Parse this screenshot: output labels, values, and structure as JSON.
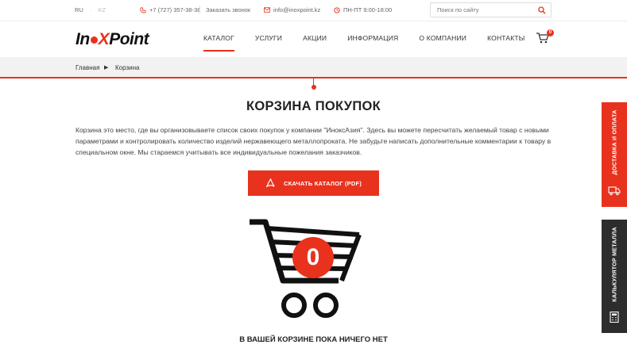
{
  "topbar": {
    "lang_ru": "RU",
    "lang_sep": "·",
    "lang_kz": "KZ",
    "phone": "+7 (727) 357-38-38",
    "callback": "Заказать звонок",
    "email": "info@inoxpoint.kz",
    "hours": "ПН-ПТ  9:00-18:00",
    "search_placeholder": "Поиск по сайту"
  },
  "header": {
    "logo": {
      "part1": "In",
      "part2": "X",
      "part3": "Point"
    },
    "nav": [
      {
        "label": "КАТАЛОГ",
        "active": true
      },
      {
        "label": "УСЛУГИ"
      },
      {
        "label": "АКЦИИ"
      },
      {
        "label": "ИНФОРМАЦИЯ"
      },
      {
        "label": "О КОМПАНИИ"
      },
      {
        "label": "КОНТАКТЫ"
      }
    ],
    "cart_count": "0"
  },
  "breadcrumb": {
    "home": "Главная",
    "current": "Корзина"
  },
  "main": {
    "title": "КОРЗИНА ПОКУПОК",
    "description": "Корзина это место, где вы организовываете список своих покупок у компании \"ИноксАзия\". Здесь вы можете пересчитать желаемый товар с новыми параметрами и контролировать количество изделий нержавеющего металлопроката. Не забудьте написать дополнительные комментарии к товару в специальном окне. Мы стараемся учитывать все индивидуальные пожелания заказчиков.",
    "download_button": "СКАЧАТЬ КАТАЛОГ (PDF)",
    "cart_count": "0",
    "empty_message": "В ВАШЕЙ КОРЗИНЕ ПОКА НИЧЕГО НЕТ"
  },
  "side_tabs": {
    "delivery": "ДОСТАВКА И ОПЛАТА",
    "calculator": "КАЛЬКУЛЯТОР МЕТАЛЛА"
  },
  "colors": {
    "accent": "#e8321e",
    "dark_tab": "#2d2d2d",
    "breadcrumb_bg": "#f2f2f2"
  }
}
